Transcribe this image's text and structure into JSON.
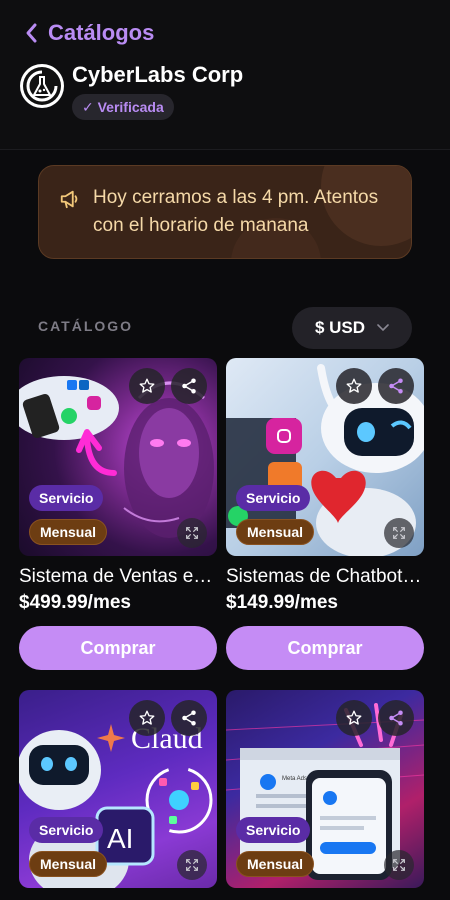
{
  "header": {
    "back_label": "Catálogos",
    "company_name": "CyberLabs Corp",
    "verified_label": "✓ Verificada"
  },
  "notice": {
    "text": "Hoy cerramos a las 4 pm. Atentos con el horario de manana"
  },
  "catalog": {
    "section_label": "CATÁLOGO",
    "currency_label": "$ USD",
    "products": [
      {
        "name": "Sistema de Ventas e…",
        "price": "$499.99/mes",
        "tag_type": "Servicio",
        "tag_billing": "Mensual",
        "buy_label": "Comprar"
      },
      {
        "name": "Sistemas de Chatbot…",
        "price": "$149.99/mes",
        "tag_type": "Servicio",
        "tag_billing": "Mensual",
        "buy_label": "Comprar"
      },
      {
        "tag_type": "Servicio",
        "tag_billing": "Mensual",
        "image_text": "Claud",
        "image_badge": "AI"
      },
      {
        "tag_type": "Servicio",
        "tag_billing": "Mensual",
        "image_text": "Meta Ads Manager"
      }
    ]
  },
  "colors": {
    "accent": "#b98cf3",
    "button": "#c58cf5",
    "notice_bg": "#3a2418",
    "notice_text": "#f5d9a8",
    "tag_service": "#5a2ca6",
    "tag_monthly": "#6d3d12"
  }
}
